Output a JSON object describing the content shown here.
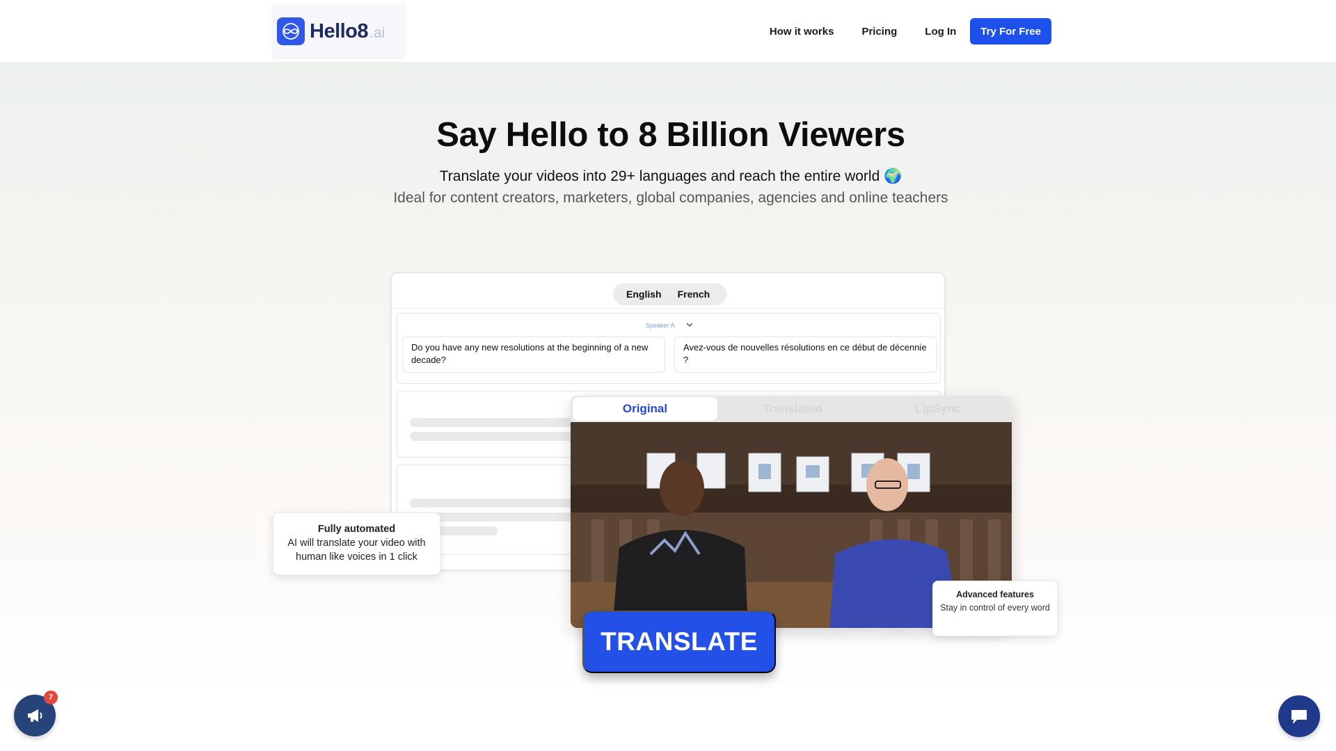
{
  "nav": {
    "logo_text": "Hello8",
    "logo_suffix": ".ai",
    "links": [
      "How it works",
      "Pricing",
      "Log In"
    ],
    "cta": "Try For Free"
  },
  "hero": {
    "title": "Say Hello to 8 Billion Viewers",
    "subtitle": "Translate your videos into 29+ languages and reach the entire world 🌍",
    "subtitle2": "Ideal for content creators, marketers, global companies, agencies and online teachers"
  },
  "editor": {
    "languages": [
      "English",
      "French"
    ],
    "speaker": "Speaker A",
    "source_text": "Do you have any new resolutions at the beginning of a new decade?",
    "target_text": "Avez-vous de nouvelles résolutions en ce début de décennie ?"
  },
  "video": {
    "tabs": [
      "Original",
      "Translated",
      "LipSync"
    ],
    "active_tab": "Original"
  },
  "translate_button": "TRANSLATE",
  "callouts": {
    "automated_title": "Fully automated",
    "automated_body": "AI will translate your video with human like voices in 1 click",
    "advanced_title": "Advanced features",
    "advanced_body": "Stay in control of every word"
  },
  "widgets": {
    "announcement_badge": "7"
  },
  "colors": {
    "brand_blue": "#1e50ec",
    "active_tab_text": "#2647d6",
    "badge_red": "#e2473e",
    "chat_navy": "#1f3a8a"
  },
  "icons": [
    "infinity-logo-icon",
    "chevron-down-icon",
    "megaphone-icon",
    "chat-bubble-icon"
  ]
}
